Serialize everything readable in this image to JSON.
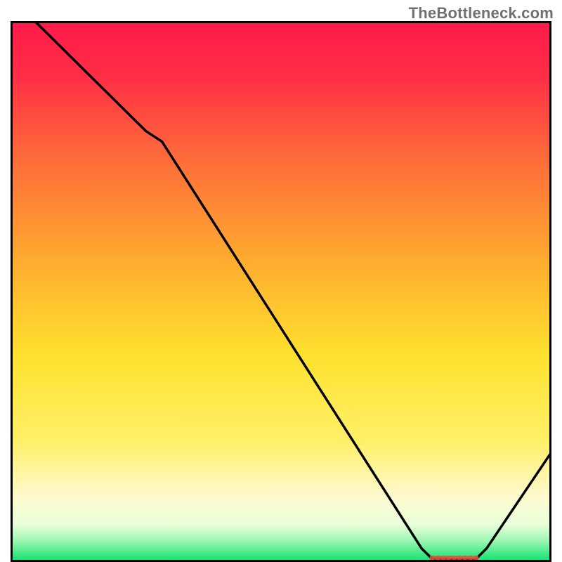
{
  "watermark": "TheBottleneck.com",
  "colors": {
    "top": "#ff1a4b",
    "yellow": "#ffe22e",
    "paleyellow": "#fff9c9",
    "green": "#00e870",
    "frame": "#000000",
    "line": "#000000",
    "mark": "#e84a3a"
  },
  "chart_data": {
    "type": "line",
    "title": "",
    "xlabel": "",
    "ylabel": "",
    "xlim": [
      0,
      100
    ],
    "ylim": [
      0,
      100
    ],
    "x": [
      0,
      5,
      25,
      28,
      76,
      78,
      86,
      88,
      100
    ],
    "values": [
      105,
      100,
      80,
      78,
      2,
      0,
      0,
      2,
      20
    ],
    "plateau_x": [
      78,
      86
    ],
    "notes": "Values are read off the vertical position relative to the square plot area; no numeric tick labels are visible in the image, so x/y are on a 0–100 scale matching the plot box."
  }
}
